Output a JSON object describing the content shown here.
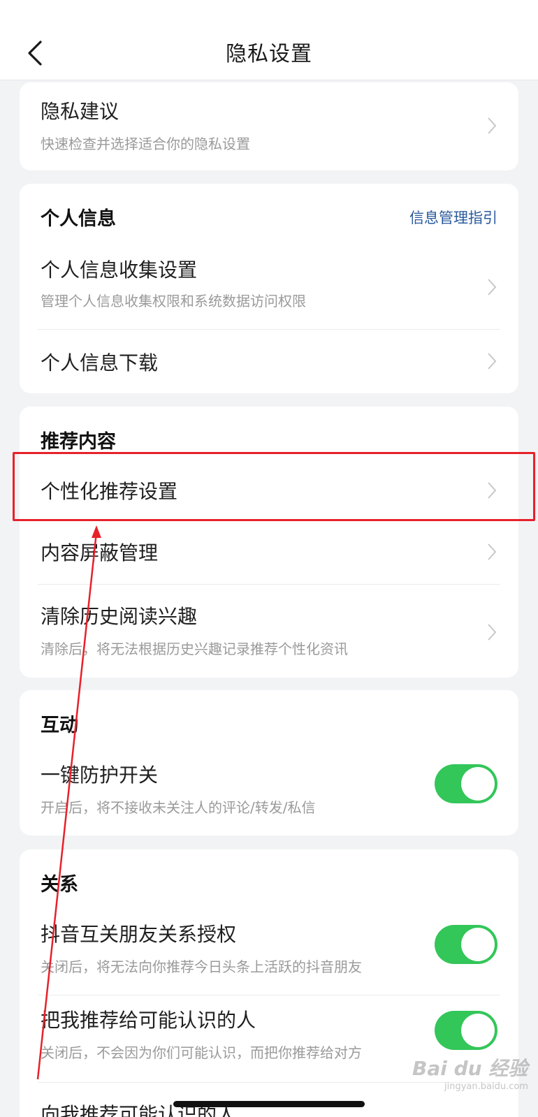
{
  "header": {
    "title": "隐私设置",
    "back_icon": "chevron-left-icon"
  },
  "privacy_suggestion": {
    "title": "隐私建议",
    "subtitle": "快速检查并选择适合你的隐私设置"
  },
  "personal_info": {
    "section_title": "个人信息",
    "guide_link": "信息管理指引",
    "items": [
      {
        "title": "个人信息收集设置",
        "subtitle": "管理个人信息收集权限和系统数据访问权限"
      },
      {
        "title": "个人信息下载"
      }
    ]
  },
  "recommend": {
    "section_title": "推荐内容",
    "items": [
      {
        "title": "个性化推荐设置"
      },
      {
        "title": "内容屏蔽管理"
      },
      {
        "title": "清除历史阅读兴趣",
        "subtitle": "清除后，将无法根据历史兴趣记录推荐个性化资讯"
      }
    ]
  },
  "interaction": {
    "section_title": "互动",
    "items": [
      {
        "title": "一键防护开关",
        "subtitle": "开启后，将不接收未关注人的评论/转发/私信",
        "toggle_on": true
      }
    ]
  },
  "relationship": {
    "section_title": "关系",
    "items": [
      {
        "title": "抖音互关朋友关系授权",
        "subtitle": "关闭后，将无法向你推荐今日头条上活跃的抖音朋友",
        "toggle_on": true
      },
      {
        "title": "把我推荐给可能认识的人",
        "subtitle": "关闭后，不会因为你们可能认识，而把你推荐给对方",
        "toggle_on": true
      },
      {
        "title": "向我推荐可能认识的人"
      }
    ]
  },
  "watermark": {
    "text": "Bai du 经验",
    "sub": "jingyan.baidu.com"
  },
  "colors": {
    "toggle_on": "#33c659",
    "annotation": "#e8202a",
    "link": "#2a5a9c"
  }
}
